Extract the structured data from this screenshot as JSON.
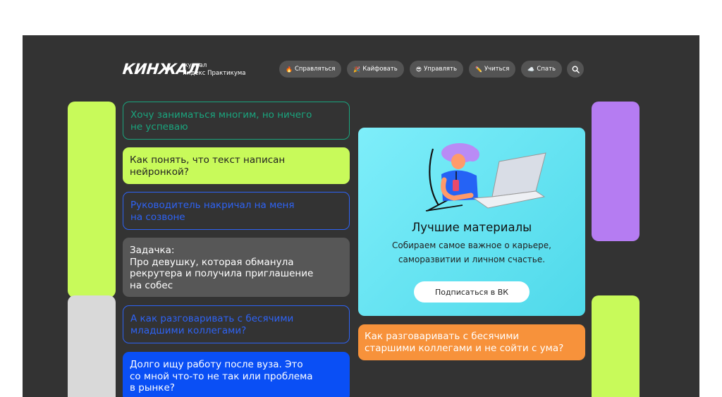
{
  "header": {
    "logo": "КИНЖАЛ",
    "logo_sub_1": "журнал",
    "logo_sub_2": "Яндекс Практикума",
    "nav": [
      {
        "emoji": "🔥",
        "label": "Справляться"
      },
      {
        "emoji": "🎉",
        "label": "Кайфовать"
      },
      {
        "emoji": "😎",
        "label": "Управлять"
      },
      {
        "emoji": "✏️",
        "label": "Учиться"
      },
      {
        "emoji": "☁️",
        "label": "Спать"
      }
    ],
    "search_icon": "search-icon"
  },
  "cards": {
    "c1": "Хочу заниматься многим, но ничего\nне успеваю",
    "c2": "Как понять, что текст написан\nнейронкой?",
    "c3": "Руководитель накричал на меня\nна созвоне",
    "c4": "Задачка:\nПро девушку, которая обманула\nрекрутера и получила приглашение\nна собес",
    "c5": "А как разговаривать с бесячими\nмладшими коллегами?",
    "c6": "Долго ищу работу после вуза. Это\nсо мной что-то не так или проблема\nв рынке?"
  },
  "promo": {
    "title": "Лучшие материалы",
    "subtitle": "Собираем самое важное о карьере,\nсаморазвитии и личном счастье.",
    "button": "Подписаться в ВК"
  },
  "orange_card": "Как разговаривать с бесячими\nстаршими коллегами и не сойти с ума?",
  "colors": {
    "background": "#333333",
    "lime": "#c8fa5a",
    "purple": "#b57cf2",
    "blue": "#0a4ff5",
    "orange": "#f7923b",
    "cyan": "#7eeefa"
  }
}
